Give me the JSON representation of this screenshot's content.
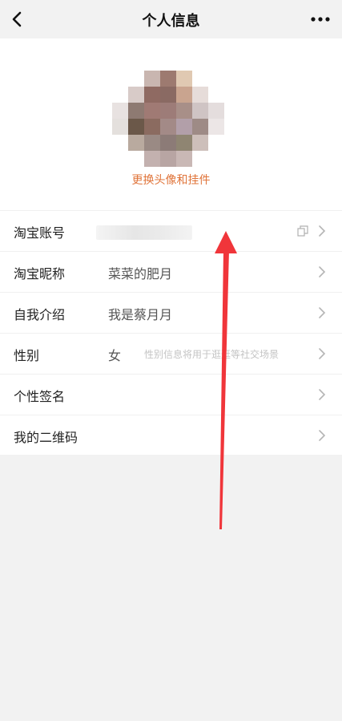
{
  "header": {
    "title": "个人信息",
    "back_icon": "chevron-left-icon",
    "more_icon": "more-dots-icon"
  },
  "profile": {
    "change_avatar_label": "更换头像和挂件"
  },
  "rows": [
    {
      "label": "淘宝账号",
      "value": "",
      "hint": ""
    },
    {
      "label": "淘宝昵称",
      "value": "菜菜的肥月",
      "hint": ""
    },
    {
      "label": "自我介绍",
      "value": "我是蔡月月",
      "hint": ""
    },
    {
      "label": "性别",
      "value": "女",
      "hint": "性别信息将用于逛逛等社交场景"
    },
    {
      "label": "个性签名",
      "value": "",
      "hint": ""
    },
    {
      "label": "我的二维码",
      "value": "",
      "hint": ""
    }
  ],
  "colors": {
    "accent": "#e0743a",
    "annotation_arrow": "#f0353a"
  }
}
